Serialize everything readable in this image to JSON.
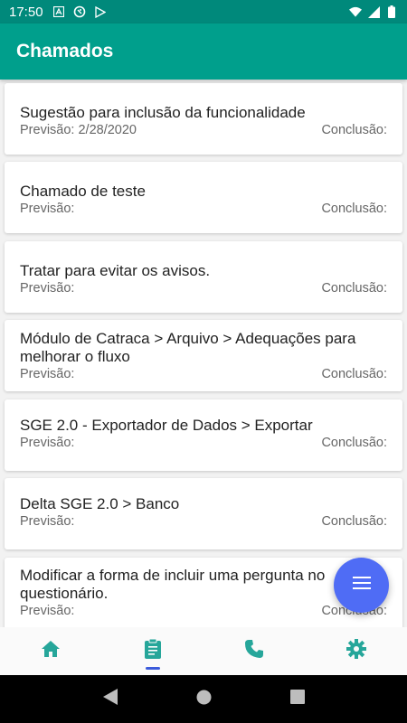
{
  "status_bar": {
    "time": "17:50",
    "left_icons": [
      "notification-a-icon",
      "sync-icon",
      "play-store-icon"
    ],
    "right_icons": [
      "wifi-icon",
      "signal-icon",
      "battery-icon"
    ]
  },
  "app_bar": {
    "title": "Chamados"
  },
  "tickets": [
    {
      "title": "Sugestão para inclusão da funcionalidade",
      "forecast": "Previsão: 2/28/2020",
      "conclusion": "Conclusão:"
    },
    {
      "title": "Chamado de teste",
      "forecast": "Previsão:",
      "conclusion": "Conclusão:"
    },
    {
      "title": "Tratar para evitar os avisos.",
      "forecast": "Previsão:",
      "conclusion": "Conclusão:"
    },
    {
      "title": "Módulo de Catraca > Arquivo > Adequações para melhorar o fluxo",
      "forecast": "Previsão:",
      "conclusion": "Conclusão:"
    },
    {
      "title": "SGE 2.0 - Exportador de Dados > Exportar",
      "forecast": "Previsão:",
      "conclusion": "Conclusão:"
    },
    {
      "title": "Delta SGE 2.0 > Banco",
      "forecast": "Previsão:",
      "conclusion": "Conclusão:"
    },
    {
      "title": "Modificar a forma de incluir uma pergunta no questionário.",
      "forecast": "Previsão:",
      "conclusion": "Conclusão:"
    }
  ],
  "fab": {
    "icon": "menu-icon"
  },
  "bottom_nav": {
    "items": [
      {
        "icon": "home-icon",
        "active": false
      },
      {
        "icon": "clipboard-icon",
        "active": true
      },
      {
        "icon": "phone-icon",
        "active": false
      },
      {
        "icon": "gear-icon",
        "active": false
      }
    ]
  },
  "colors": {
    "app_bar": "#009f8c",
    "status_bar": "#00897b",
    "fab": "#4f6cf5",
    "nav_icon": "#26a69a",
    "nav_indicator": "#3b5bdb"
  }
}
